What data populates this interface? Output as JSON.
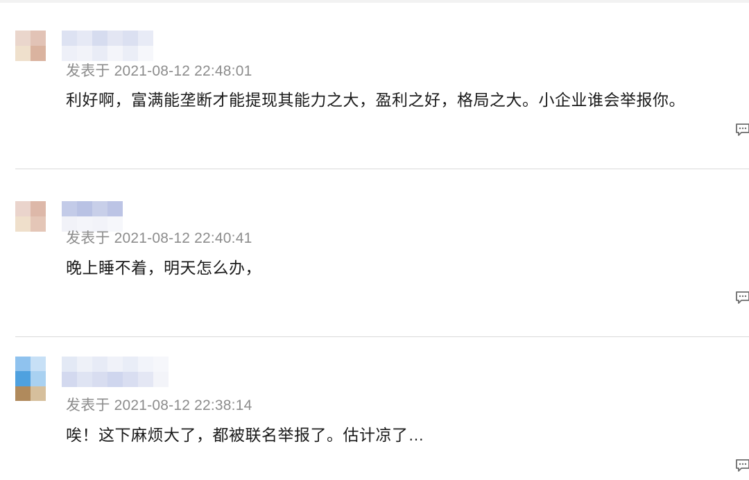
{
  "comments": [
    {
      "username_redacted": true,
      "meta_prefix": "发表于",
      "timestamp": "2021-08-12 22:48:01",
      "content": "利好啊，富满能垄断才能提现其能力之大，盈利之好，格局之大。小企业谁会举报你。",
      "reply_icon": "comment-reply-icon"
    },
    {
      "username_redacted": true,
      "meta_prefix": "发表于",
      "timestamp": "2021-08-12 22:40:41",
      "content": "晚上睡不着，明天怎么办，",
      "reply_icon": "comment-reply-icon"
    },
    {
      "username_redacted": true,
      "meta_prefix": "发表于",
      "timestamp": "2021-08-12 22:38:14",
      "content": "唉！这下麻烦大了，都被联名举报了。估计凉了…",
      "reply_icon": "comment-reply-icon"
    }
  ],
  "colors": {
    "text": "#1a1a1a",
    "meta": "#8c8c8c",
    "divider": "#d9d9d9",
    "icon": "#6b6b6b"
  }
}
